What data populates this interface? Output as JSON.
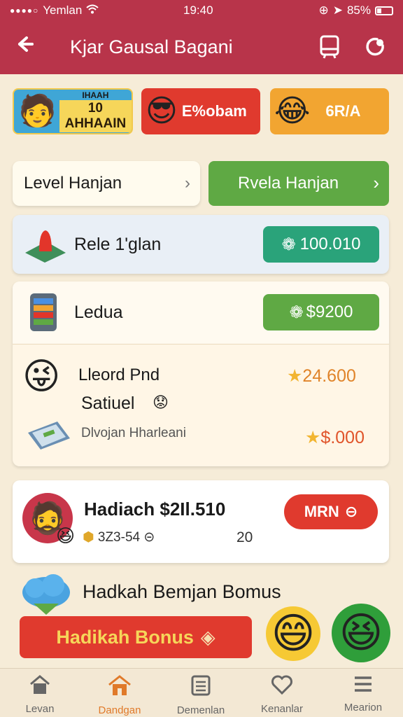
{
  "status": {
    "carrier": "Yemlan",
    "time": "19:40",
    "battery": "85%"
  },
  "header": {
    "title": "Kjar Gausal Bagani"
  },
  "promos": [
    {
      "label": "10 AHHAAIN",
      "sub": "IHAAH",
      "icon": "smiling-face"
    },
    {
      "label": "E%obam",
      "icon": "sunglasses-face"
    },
    {
      "label": "6R/A",
      "icon": "crying-laughing-face"
    }
  ],
  "levels": {
    "left_label": "Level Hanjan",
    "right_label": "Rvela Hanjan"
  },
  "row1": {
    "label": "Rele 1'glan",
    "amount": "100.010"
  },
  "row2": {
    "label": "Ledua",
    "amount": "$9200",
    "sub1": "Lleord Pnd",
    "sub1_value": "24.600",
    "sub2": "Satiuel",
    "sub3": "Dlvojan Hharleani",
    "sub3_value": "$.000"
  },
  "hadiach": {
    "title": "Hadiach $2Il.510",
    "meta1": "3Z3-54",
    "meta2": "20",
    "button": "MRN"
  },
  "bonus": {
    "heading": "Hadkah Bemjan Bomus",
    "button": "Hadikah Bonus"
  },
  "nav": [
    {
      "label": "Levan",
      "icon": "home-icon"
    },
    {
      "label": "Dandgan",
      "icon": "house-active-icon"
    },
    {
      "label": "Demenlan",
      "icon": "list-icon"
    },
    {
      "label": "Kenanlar",
      "icon": "heart-icon"
    },
    {
      "label": "Mearion",
      "icon": "menu-icon"
    }
  ],
  "colors": {
    "header": "#b8344a",
    "green": "#5fa944",
    "teal": "#2aa37a",
    "red": "#d93a2e",
    "orange": "#f2a531"
  }
}
